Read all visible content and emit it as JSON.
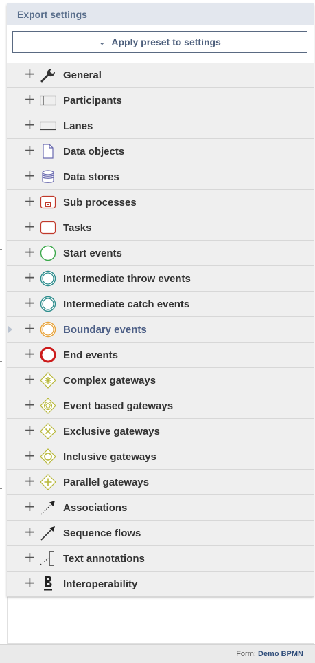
{
  "panel": {
    "title": "Export settings",
    "preset_label": "Apply preset to settings",
    "expand_symbol": "+"
  },
  "items": [
    {
      "label": "General",
      "icon": "wrench-icon"
    },
    {
      "label": "Participants",
      "icon": "participant-pool-icon"
    },
    {
      "label": "Lanes",
      "icon": "lane-icon"
    },
    {
      "label": "Data objects",
      "icon": "data-object-icon"
    },
    {
      "label": "Data stores",
      "icon": "data-store-icon"
    },
    {
      "label": "Sub processes",
      "icon": "sub-process-icon"
    },
    {
      "label": "Tasks",
      "icon": "task-icon"
    },
    {
      "label": "Start events",
      "icon": "start-event-icon"
    },
    {
      "label": "Intermediate throw events",
      "icon": "intermediate-throw-event-icon"
    },
    {
      "label": "Intermediate catch events",
      "icon": "intermediate-catch-event-icon"
    },
    {
      "label": "Boundary events",
      "icon": "boundary-event-icon"
    },
    {
      "label": "End events",
      "icon": "end-event-icon"
    },
    {
      "label": "Complex gateways",
      "icon": "complex-gateway-icon"
    },
    {
      "label": "Event based gateways",
      "icon": "event-based-gateway-icon"
    },
    {
      "label": "Exclusive gateways",
      "icon": "exclusive-gateway-icon"
    },
    {
      "label": "Inclusive gateways",
      "icon": "inclusive-gateway-icon"
    },
    {
      "label": "Parallel gateways",
      "icon": "parallel-gateway-icon"
    },
    {
      "label": "Associations",
      "icon": "association-icon"
    },
    {
      "label": "Sequence flows",
      "icon": "sequence-flow-icon"
    },
    {
      "label": "Text annotations",
      "icon": "text-annotation-icon"
    },
    {
      "label": "Interoperability",
      "icon": "interoperability-icon"
    }
  ],
  "footer": {
    "form_label": "Form:",
    "form_name": "Demo BPMN"
  },
  "colors": {
    "header_text": "#5a6f8c",
    "selected_text": "#4d5f86",
    "task_red": "#c0392b",
    "event_green": "#3aa84a",
    "intermediate_teal": "#2c8c8c",
    "boundary_orange": "#e8a33a",
    "end_red": "#cc1b1b",
    "gateway_olive": "#b8b83a",
    "data_blue": "#6a6ab0"
  }
}
